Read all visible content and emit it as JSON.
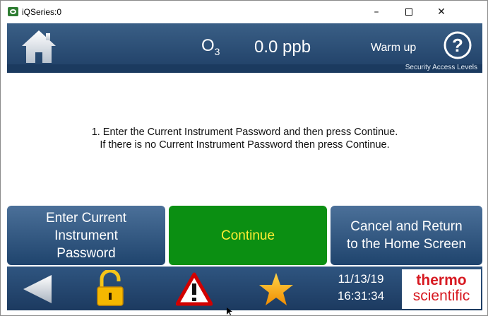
{
  "window": {
    "title": "iQSeries:0",
    "minimize": "–",
    "close": "✕"
  },
  "header": {
    "gas_label": "O",
    "gas_subscript": "3",
    "reading": "0.0 ppb",
    "status": "Warm up",
    "breadcrumb": "Security Access Levels",
    "icons": [
      "home-icon",
      "help-icon"
    ]
  },
  "message": {
    "line1": "1. Enter the Current Instrument Password and then press Continue.",
    "line2": "If there is no Current Instrument Password then press Continue."
  },
  "buttons": {
    "enter_password": "Enter Current\nInstrument\nPassword",
    "continue": "Continue",
    "cancel": "Cancel and Return\nto the Home Screen"
  },
  "footer": {
    "date": "11/13/19",
    "time": "16:31:34",
    "logo_line1": "thermo",
    "logo_line2": "scientific",
    "icons": [
      "back-arrow-icon",
      "lock-icon",
      "alarm-warning-icon",
      "favorites-star-icon"
    ]
  },
  "colors": {
    "header_blue": "#2a4d75",
    "continue_green": "#0b8f12",
    "continue_text": "#ffee33",
    "logo_red": "#d71921"
  }
}
